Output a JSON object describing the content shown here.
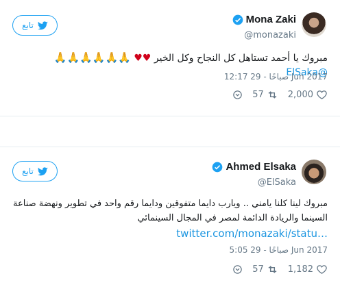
{
  "tweets": [
    {
      "display_name": "Mona Zaki",
      "handle": "@monazaki",
      "follow_label": "تابع",
      "text_prefix": "@ElSaka",
      "text_emoji": "🙏🙏🙏🙏🙏🙏",
      "text_hearts": "♥♥",
      "text_main": "مبروك يا أحمد تستاهل كل النجاح وكل الخير",
      "timestamp": "12:17 صباحًا - 29 Jun 2017",
      "likes": "2,000",
      "retweets": "57"
    },
    {
      "display_name": "Ahmed Elsaka",
      "handle": "@ElSaka",
      "follow_label": "تابع",
      "text_line1": "مبروك لينا كلنا يامني .. ويارب دايما متفوقين ودايما رقم واحد في تطوير ونهضة صناعة",
      "text_line2": "السينما والريادة الدائمة لمصر في المجال السينمائي",
      "link": "twitter.com/monazaki/statu…",
      "timestamp": "5:05 صباحًا - 29 Jun 2017",
      "likes": "1,182",
      "retweets": "57"
    }
  ],
  "colors": {
    "accent": "#1da1f2",
    "link": "#1b95e0",
    "muted": "#657786",
    "heart": "#d0021b"
  },
  "icons": [
    "twitter-bird-icon",
    "verified-icon",
    "heart-icon",
    "retweet-icon",
    "more-icon"
  ]
}
